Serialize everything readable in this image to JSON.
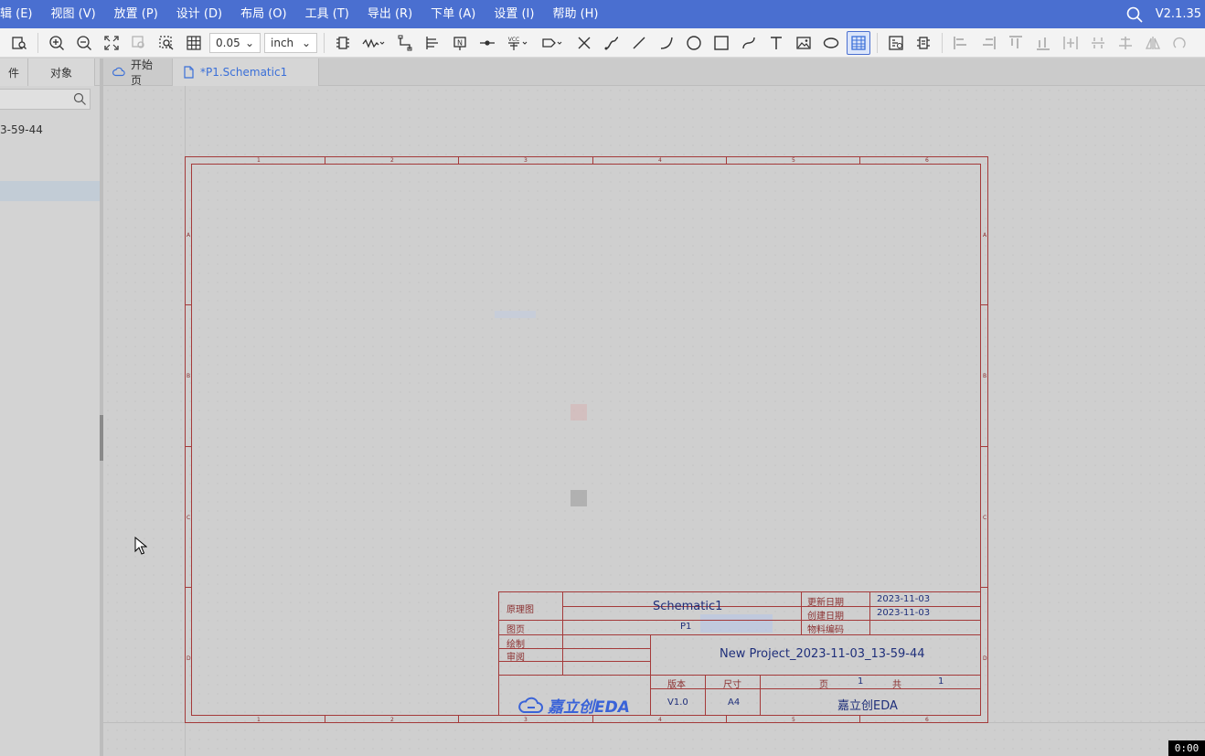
{
  "menubar": {
    "items": [
      "辑 (E)",
      "视图 (V)",
      "放置 (P)",
      "设计 (D)",
      "布局 (O)",
      "工具 (T)",
      "导出 (R)",
      "下单 (A)",
      "设置 (I)",
      "帮助 (H)"
    ],
    "version": "V2.1.35",
    "search_icon": "search-icon"
  },
  "toolbar": {
    "grid_value": "0.05",
    "unit_value": "inch",
    "icons": [
      "find-icon",
      "zoom-in-icon",
      "zoom-out-icon",
      "fit-view-icon",
      "zoom-area-icon",
      "zoom-selection-icon",
      "grid-icon",
      "component-icon",
      "net-label-icon",
      "wire-icon",
      "bus-icon",
      "net-port-icon",
      "junction-icon",
      "vcc-icon",
      "port-icon",
      "no-connect-icon",
      "bus-entry-icon",
      "line-icon",
      "arc-icon",
      "circle-icon",
      "rectangle-icon",
      "bezier-icon",
      "text-icon",
      "image-icon",
      "ellipse-icon",
      "table-icon",
      "drc-icon",
      "netlist-icon",
      "align-left-icon",
      "align-right-icon",
      "align-top-icon",
      "align-bottom-icon",
      "distribute-h-icon",
      "distribute-v-icon",
      "align-center-icon",
      "mirror-icon"
    ]
  },
  "leftpanel": {
    "tabs": [
      "件",
      "对象"
    ],
    "project_name_fragment": "3-59-44"
  },
  "doctabs": {
    "start_label": "开始页",
    "schematic_label": "*P1.Schematic1"
  },
  "sheet": {
    "col_labels": [
      "1",
      "2",
      "3",
      "4",
      "5",
      "6"
    ],
    "row_labels": [
      "A",
      "B",
      "C",
      "D"
    ]
  },
  "titleblock": {
    "type_label": "原理图",
    "sheet_name": "Schematic1",
    "updated_label": "更新日期",
    "updated_value": "2023-11-03",
    "created_label": "创建日期",
    "created_value": "2023-11-03",
    "material_label": "物料编码",
    "page_label": "图页",
    "page_value": "P1",
    "drawn_label": "绘制",
    "review_label": "审阅",
    "project_name": "New Project_2023-11-03_13-59-44",
    "version_label": "版本",
    "version_value": "V1.0",
    "size_label": "尺寸",
    "size_value": "A4",
    "page_of_label": "页",
    "page_num": "1",
    "total_label": "共",
    "total_num": "1",
    "company": "嘉立创EDA",
    "logo_text": "嘉立创EDA"
  },
  "timer": "0:00",
  "colors": {
    "menubar": "#4a6fd0",
    "accent": "#3a6fd8",
    "sheet_border": "#a43a3a",
    "title_text": "#1f2f7a"
  }
}
